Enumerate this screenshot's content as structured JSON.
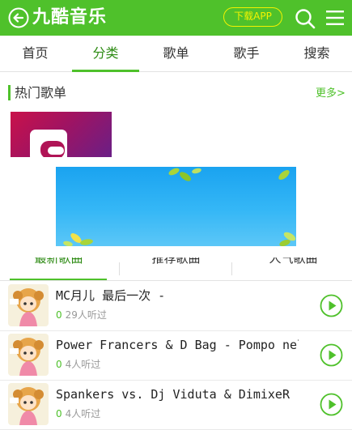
{
  "header": {
    "logo": "九酷音乐",
    "download_label": "下载APP",
    "icons": [
      "back-arrow-icon",
      "search-icon",
      "menu-icon"
    ],
    "color": "#4fc12b"
  },
  "nav": {
    "tabs": [
      {
        "label": "首页",
        "active": false
      },
      {
        "label": "分类",
        "active": true
      },
      {
        "label": "歌单",
        "active": false
      },
      {
        "label": "歌手",
        "active": false
      },
      {
        "label": "搜索",
        "active": false
      }
    ]
  },
  "hot_playlists": {
    "title": "热门歌单",
    "more_label": "更多>"
  },
  "subtabs": [
    {
      "label": "最新歌曲",
      "active": true
    },
    {
      "label": "推荐歌曲",
      "active": false
    },
    {
      "label": "人气歌曲",
      "active": false
    }
  ],
  "songs": [
    {
      "title": "MC月儿 最后一次 -",
      "count": "0",
      "listen": "29人听过"
    },
    {
      "title": "Power Francers & D Bag - Pompo nelle",
      "count": "0",
      "listen": "4人听过"
    },
    {
      "title": "Spankers vs. Dj Viduta & DimixeR -",
      "count": "0",
      "listen": "4人听过"
    }
  ]
}
